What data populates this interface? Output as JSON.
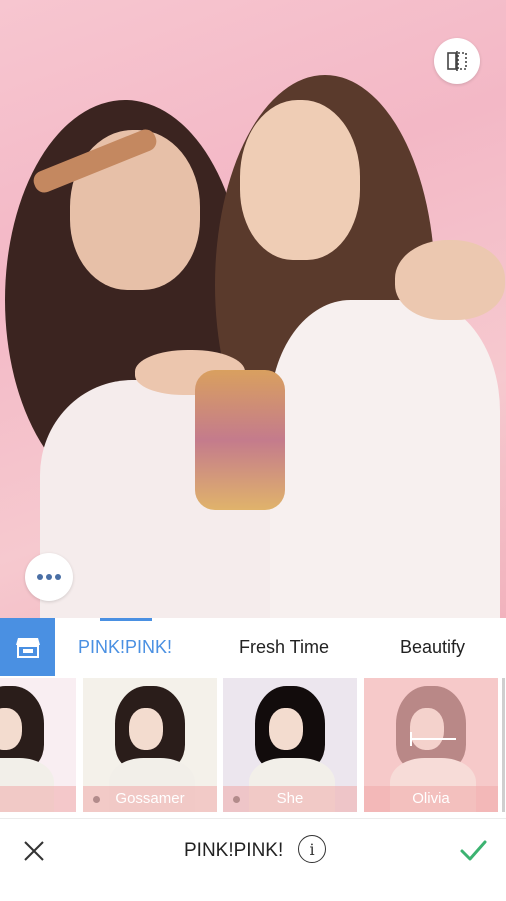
{
  "tabs": {
    "store_icon": "store-icon",
    "items": [
      {
        "label": "PINK!PINK!",
        "active": true
      },
      {
        "label": "Fresh Time",
        "active": false
      },
      {
        "label": "Beautify",
        "active": false
      }
    ]
  },
  "thumbnails": [
    {
      "label": "ather"
    },
    {
      "label": "Gossamer"
    },
    {
      "label": "She"
    },
    {
      "label": "Olivia"
    }
  ],
  "bottom": {
    "filter_name": "PINK!PINK!",
    "info_glyph": "i"
  },
  "colors": {
    "accent": "#4a90e2",
    "confirm": "#3cb371",
    "photo_tint": "#f6c6d0"
  },
  "icons": {
    "compare": "compare-icon",
    "more": "more-dots-icon",
    "close": "close-icon",
    "confirm": "checkmark-icon",
    "info": "info-icon"
  }
}
